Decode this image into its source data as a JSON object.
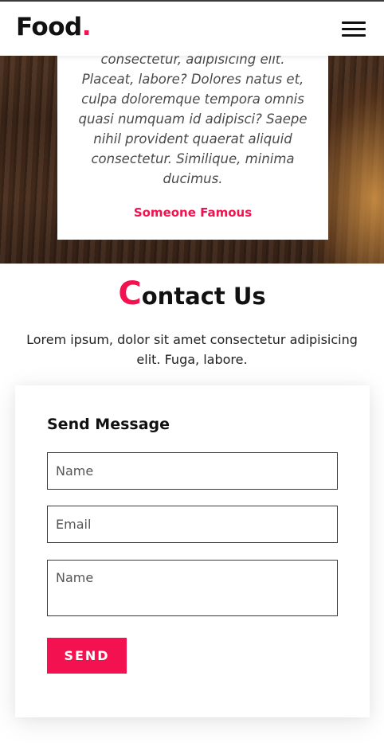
{
  "header": {
    "logo_text": "Food",
    "logo_dot": ".",
    "menu_icon": "hamburger-menu-icon"
  },
  "testimonial": {
    "quote": "consectetur, adipisicing elit. Placeat, labore? Dolores natus et, culpa doloremque tempora omnis quasi numquam id adipisci? Saepe nihil provident quaerat aliquid consectetur. Similique, minima ducimus.",
    "author": "Someone Famous"
  },
  "contact": {
    "title_first_letter": "C",
    "title_rest": "ontact Us",
    "description": "Lorem ipsum, dolor sit amet consectetur adipisicing elit. Fuga, labore."
  },
  "form": {
    "heading": "Send Message",
    "name_placeholder": "Name",
    "email_placeholder": "Email",
    "message_placeholder": "Name",
    "send_label": "SEND"
  },
  "colors": {
    "accent": "#f3114f",
    "text": "#111111"
  }
}
